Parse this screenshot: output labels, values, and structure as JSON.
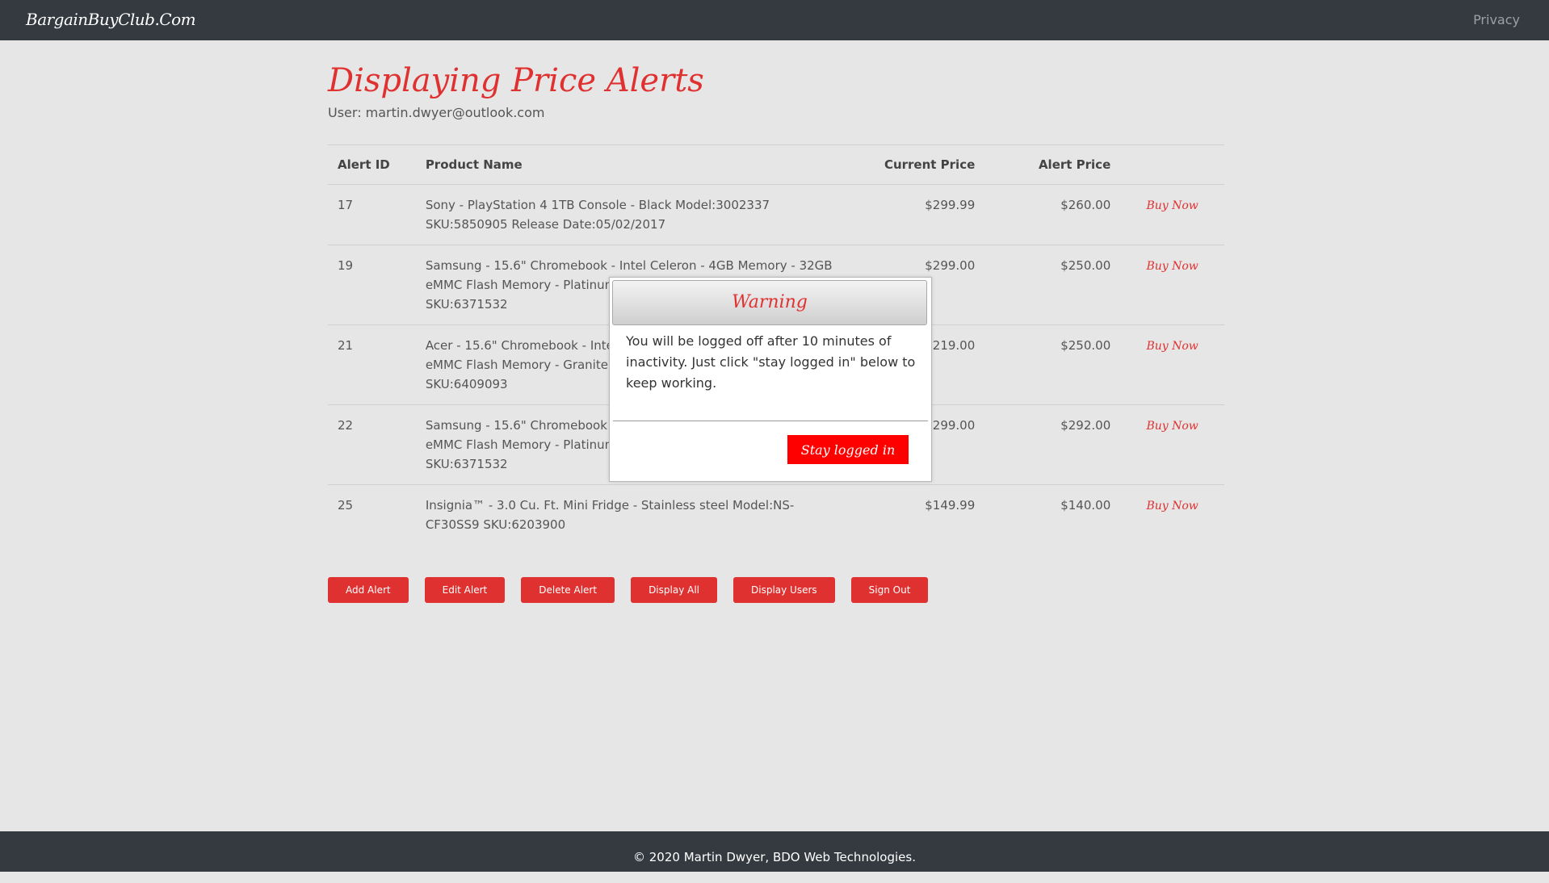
{
  "nav": {
    "brand": "BargainBuyClub.Com",
    "privacy": "Privacy"
  },
  "page": {
    "title": "Displaying Price Alerts",
    "user_line": "User: martin.dwyer@outlook.com"
  },
  "table": {
    "headers": [
      "Alert ID",
      "Product Name",
      "Current Price",
      "Alert Price",
      ""
    ],
    "rows": [
      {
        "id": "17",
        "name": "Sony - PlayStation 4 1TB Console - Black Model:3002337 SKU:5850905 Release Date:05/02/2017",
        "current": "$299.99",
        "alert": "$260.00",
        "action": "Buy Now"
      },
      {
        "id": "19",
        "name": "Samsung - 15.6\" Chromebook - Intel Celeron - 4GB Memory - 32GB eMMC Flash Memory - Platinum Titan Model:XE350XBA-K01US SKU:6371532",
        "current": "$299.00",
        "alert": "$250.00",
        "action": "Buy Now"
      },
      {
        "id": "21",
        "name": "Acer - 15.6\" Chromebook - Intel Celeron - 4GB Memory - 32GB eMMC Flash Memory - Granite Gray Model:CB315-3H-C19A SKU:6409093",
        "current": "$219.00",
        "alert": "$250.00",
        "action": "Buy Now"
      },
      {
        "id": "22",
        "name": "Samsung - 15.6\" Chromebook - Intel Celeron - 4GB Memory - 32GB eMMC Flash Memory - Platinum Titan Model:XE350XBA-K01US SKU:6371532",
        "current": "$299.00",
        "alert": "$292.00",
        "action": "Buy Now"
      },
      {
        "id": "25",
        "name": "Insignia™ - 3.0 Cu. Ft. Mini Fridge - Stainless steel Model:NS-CF30SS9 SKU:6203900",
        "current": "$149.99",
        "alert": "$140.00",
        "action": "Buy Now"
      }
    ]
  },
  "buttons": {
    "add": "Add Alert",
    "edit": "Edit Alert",
    "delete": "Delete Alert",
    "display_all": "Display All",
    "display_users": "Display Users",
    "sign_out": "Sign Out"
  },
  "modal": {
    "title": "Warning",
    "message": "You will be logged off after 10 minutes of inactivity. Just click \"stay logged in\" below to keep working.",
    "button": "Stay logged in"
  },
  "footer": {
    "text": "© 2020 Martin Dwyer, BDO Web Technologies."
  },
  "colors": {
    "accent": "#e03131",
    "navbar": "#343a40",
    "background": "#e6e6e6",
    "modal_button": "#ff0000"
  }
}
